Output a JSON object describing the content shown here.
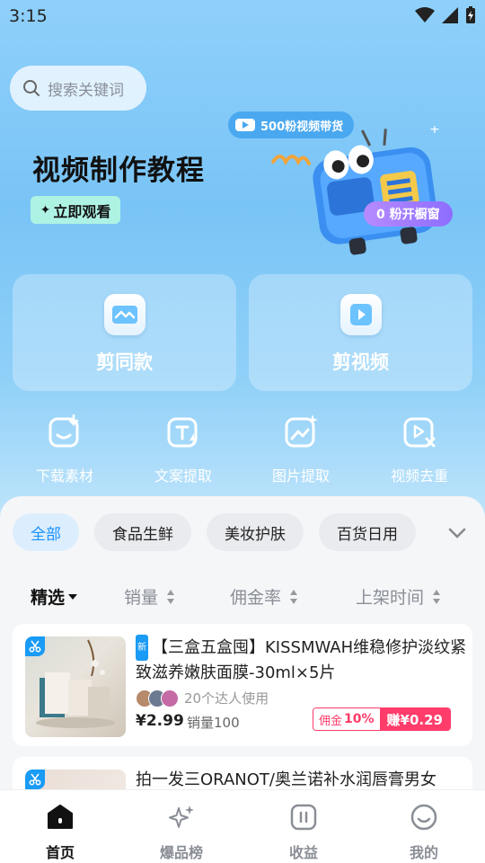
{
  "status": {
    "time": "3:15"
  },
  "search": {
    "placeholder": "搜索关键词"
  },
  "banner": {
    "title": "视频制作教程",
    "watch_label": "立即观看",
    "bubble_text": "500粉视频带货",
    "open_label": "0 粉开橱窗"
  },
  "big_actions": [
    {
      "label": "剪同款",
      "icon": "wave-icon"
    },
    {
      "label": "剪视频",
      "icon": "play-icon"
    }
  ],
  "tools": [
    {
      "label": "下载素材",
      "icon": "download-icon"
    },
    {
      "label": "文案提取",
      "icon": "text-extract-icon"
    },
    {
      "label": "图片提取",
      "icon": "image-extract-icon"
    },
    {
      "label": "视频去重",
      "icon": "video-dedupe-icon"
    }
  ],
  "categories": [
    "全部",
    "食品生鲜",
    "美妆护肤",
    "百货日用"
  ],
  "sorts": [
    "精选",
    "销量",
    "佣金率",
    "上架时间"
  ],
  "products": [
    {
      "new_tag": "新",
      "title": "【三盒五盒囤】KISSMWAH维稳修护淡纹紧致滋养嫩肤面膜-30ml×5片",
      "users_text": "20个达人使用",
      "price": "¥2.99",
      "sales": "销量100",
      "commission_label": "佣金",
      "commission_rate": "10%",
      "earn": "赚¥0.29"
    },
    {
      "title": "拍一发三ORANOT/奥兰诺补水润唇膏男女"
    }
  ],
  "nav": [
    {
      "label": "首页",
      "icon": "home-icon"
    },
    {
      "label": "爆品榜",
      "icon": "sparkle-icon"
    },
    {
      "label": "收益",
      "icon": "earnings-icon"
    },
    {
      "label": "我的",
      "icon": "profile-icon"
    }
  ],
  "colors": {
    "accent": "#1890ff",
    "commission": "#ff3c6a",
    "header_bg": "#7fc8f7"
  }
}
